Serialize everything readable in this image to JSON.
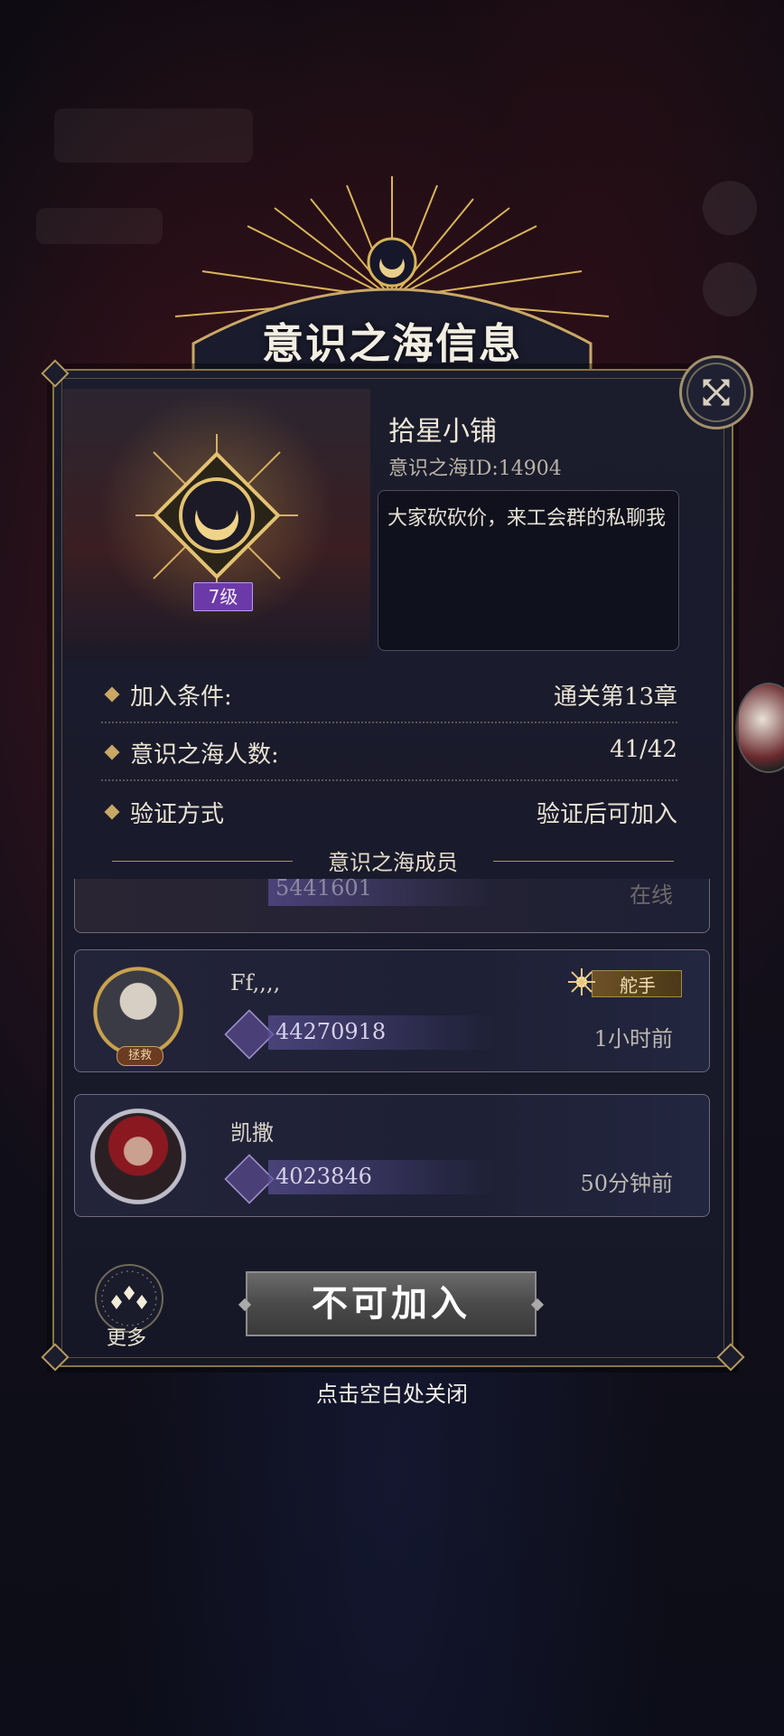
{
  "dialog": {
    "title": "意识之海信息",
    "close_hint": "点击空白处关闭"
  },
  "sea": {
    "name": "拾星小铺",
    "id_text": "意识之海ID:14904",
    "level": "7级",
    "description": "大家砍砍价，来工会群的私聊我"
  },
  "info": [
    {
      "label": "加入条件:",
      "value": "通关第13章"
    },
    {
      "label": "意识之海人数:",
      "value": "41/42"
    },
    {
      "label": "验证方式",
      "value": "验证后可加入"
    }
  ],
  "members_title": "意识之海成员",
  "members": [
    {
      "name": "Ff,,,,",
      "id": "44270918",
      "time": "1小时前",
      "role": "舵手",
      "avatar_tag": "拯救"
    },
    {
      "name": "凯撒",
      "id": "4023846",
      "time": "50分钟前"
    }
  ],
  "partial_member": {
    "id": "5441601",
    "time": "在线"
  },
  "actions": {
    "more_label": "更多",
    "join_label": "不可加入"
  },
  "colors": {
    "gold": "#c9a865",
    "level_purple": "#6c3aa8",
    "panel_bg": "#1b1c2c"
  }
}
